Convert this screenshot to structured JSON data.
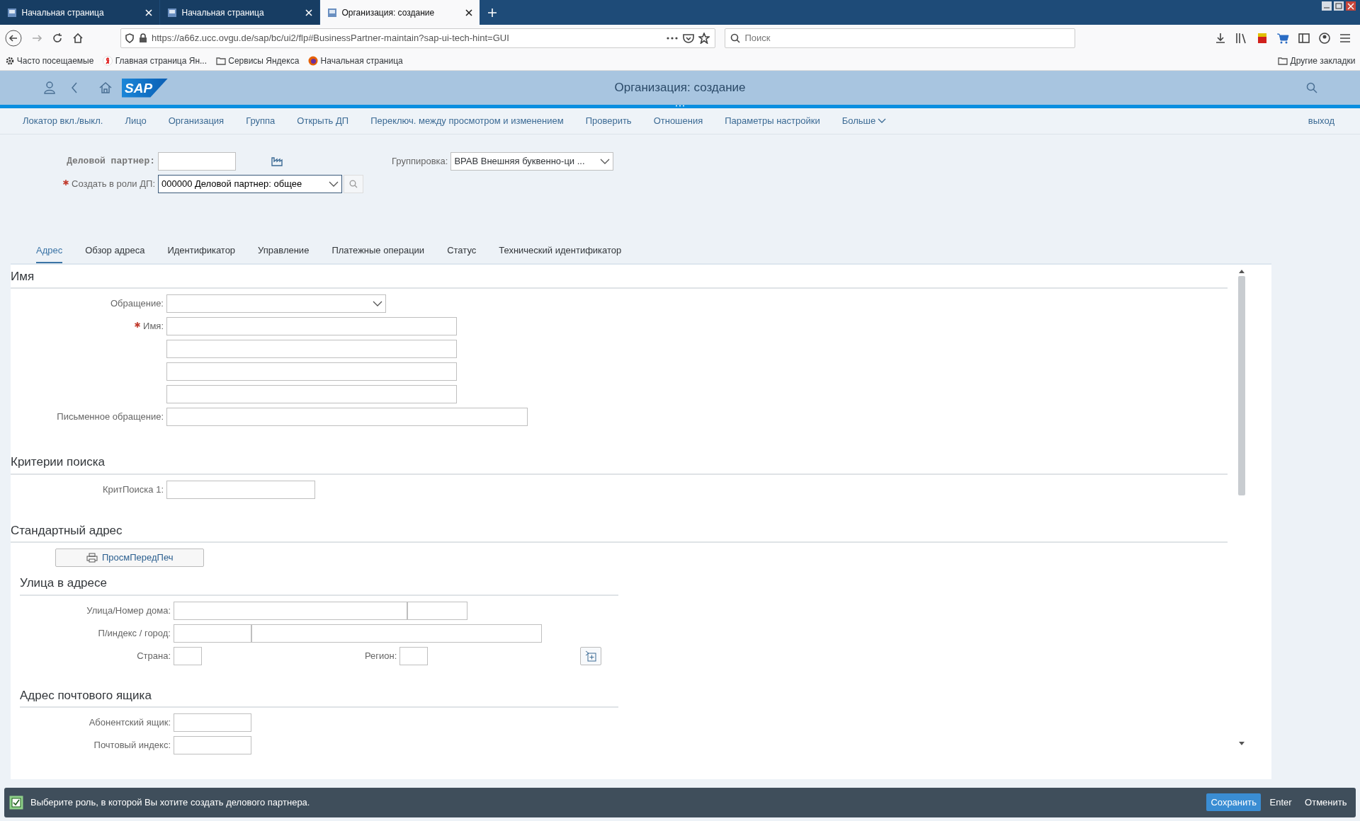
{
  "browser": {
    "tabs": [
      {
        "title": "Начальная страница",
        "selected": false
      },
      {
        "title": "Начальная страница",
        "selected": false
      },
      {
        "title": "Организация: создание",
        "selected": true
      }
    ],
    "url": "https://a66z.ucc.ovgu.de/sap/bc/ui2/flp#BusinessPartner-maintain?sap-ui-tech-hint=GUI",
    "search": {
      "placeholder": "Поиск"
    },
    "bookmarks": [
      {
        "kind": "gear",
        "label": "Часто посещаемые"
      },
      {
        "kind": "yandex",
        "label": "Главная страница Ян..."
      },
      {
        "kind": "folder",
        "label": "Сервисы Яндекса"
      },
      {
        "kind": "firefox",
        "label": "Начальная страница"
      }
    ],
    "other_bookmarks": "Другие закладки"
  },
  "shell": {
    "logo": "SAP",
    "title": "Организация: создание"
  },
  "menu": {
    "items": [
      "Локатор вкл./выкл.",
      "Лицо",
      "Организация",
      "Группа",
      "Открыть ДП",
      "Переключ. между просмотром и изменением",
      "Проверить",
      "Отношения",
      "Параметры настройки"
    ],
    "more": "Больше",
    "exit": "выход"
  },
  "header": {
    "partner": {
      "label": "Деловой партнер:"
    },
    "grouping": {
      "label": "Группировка:",
      "value": "BPAB Внешняя буквенно-ци ..."
    },
    "role": {
      "label": "Создать в роли ДП:",
      "required": true,
      "value": "000000 Деловой партнер: общее"
    }
  },
  "tabs": [
    {
      "label": "Адрес",
      "selected": true
    },
    {
      "label": "Обзор адреса",
      "selected": false
    },
    {
      "label": "Идентификатор",
      "selected": false
    },
    {
      "label": "Управление",
      "selected": false
    },
    {
      "label": "Платежные операции",
      "selected": false
    },
    {
      "label": "Статус",
      "selected": false
    },
    {
      "label": "Технический идентификатор",
      "selected": false
    }
  ],
  "sections": [
    {
      "title": "Имя",
      "rows": [
        {
          "kind": "select",
          "label": "Обращение:"
        },
        {
          "kind": "text",
          "label": "Имя:",
          "required": true
        },
        {
          "kind": "text"
        },
        {
          "kind": "text"
        },
        {
          "kind": "text"
        },
        {
          "kind": "wide",
          "label": "Письменное обращение:"
        }
      ]
    },
    {
      "title": "Критерии поиска",
      "rows": [
        {
          "kind": "medium",
          "label": "КритПоиска 1:"
        }
      ]
    },
    {
      "title": "Стандартный адрес",
      "button": "ПросмПередПеч",
      "subsections": [
        {
          "title": "Улица в адресе",
          "rows": [
            {
              "kind": "street",
              "label": "Улица/Номер дома:"
            },
            {
              "kind": "city",
              "label": "П/индекс / город:"
            },
            {
              "kind": "country",
              "label": "Страна:",
              "label2": "Регион:"
            }
          ]
        },
        {
          "title": "Адрес почтового ящика",
          "rows": [
            {
              "kind": "short",
              "label": "Абонентский ящик:"
            },
            {
              "kind": "short",
              "label": "Почтовый индекс:"
            }
          ]
        }
      ]
    }
  ],
  "footer": {
    "message": "Выберите роль, в которой Вы хотите создать делового партнера.",
    "buttons": [
      {
        "label": "Сохранить",
        "primary": true
      },
      {
        "label": "Enter",
        "primary": false
      },
      {
        "label": "Отменить",
        "primary": false
      }
    ]
  }
}
